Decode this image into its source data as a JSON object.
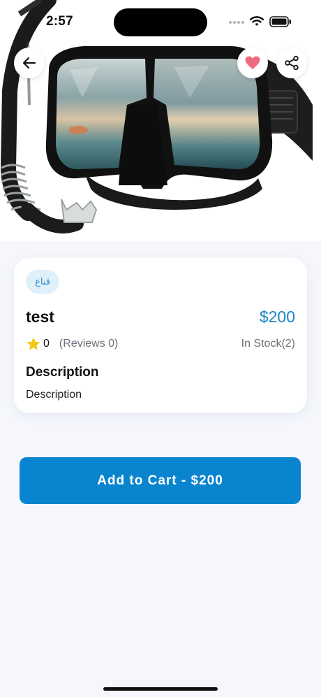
{
  "status_bar": {
    "time": "2:57"
  },
  "nav": {
    "back_icon": "arrow-left-icon",
    "favorite_icon": "heart-icon",
    "share_icon": "share-icon",
    "favorite_color": "#f06b7f"
  },
  "hero": {
    "image_subject": "snorkel mask with snorkel tube"
  },
  "product": {
    "category": "قناع",
    "name": "test",
    "price": "$200",
    "rating_value": "0",
    "reviews_text": "(Reviews 0)",
    "stock_text": "In Stock(2)",
    "description_title": "Description",
    "description_body": "Description",
    "price_color": "#1b86c4",
    "star_color": "#f5c518"
  },
  "cart": {
    "button_label": "Add to Cart - $200",
    "button_color": "#0984cf"
  }
}
